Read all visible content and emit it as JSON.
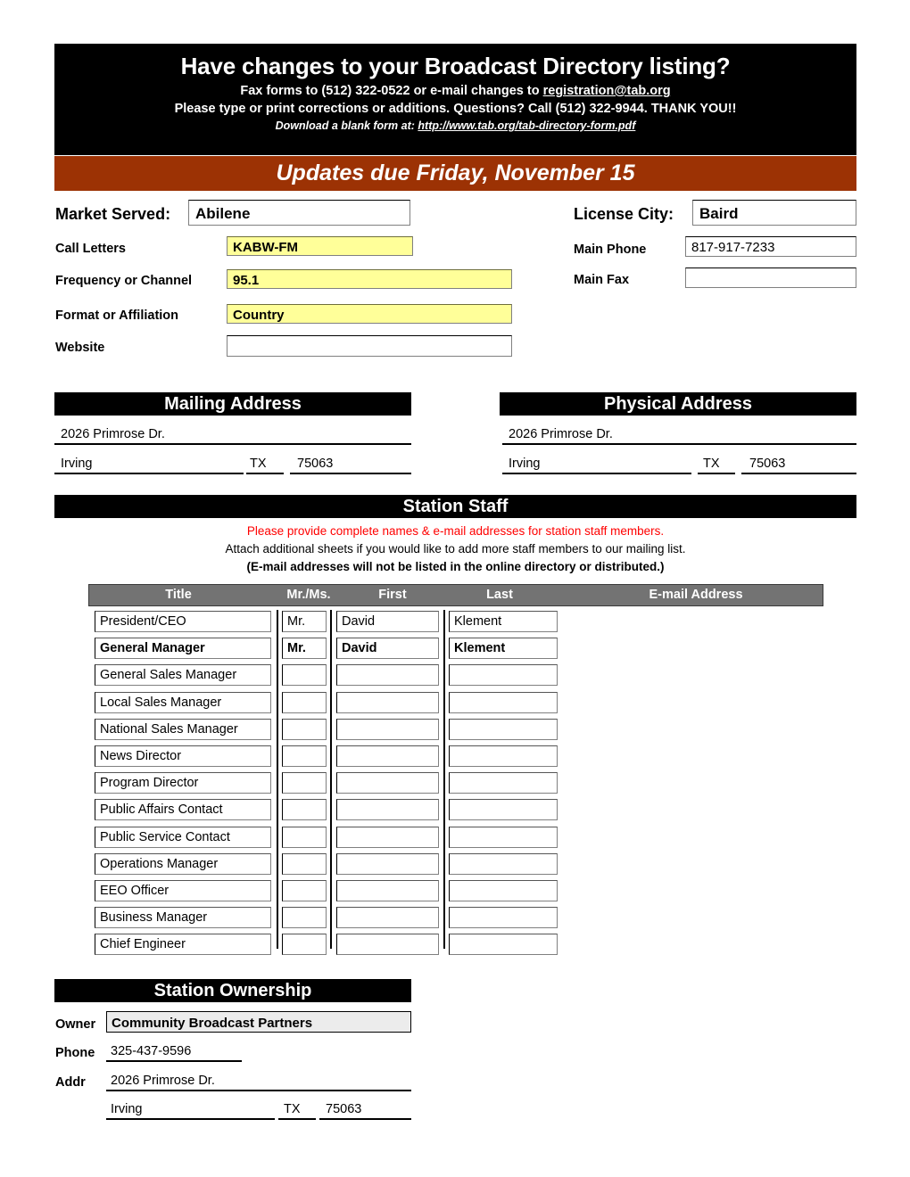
{
  "banner": {
    "title": "Have changes to your Broadcast Directory listing?",
    "line1_a": "Fax forms to (512) 322-0522 or e-mail changes to ",
    "line1_email": "registration@tab.org",
    "line2": "Please type or print corrections or additions. Questions?  Call (512) 322-9944. THANK YOU!!",
    "line3_a": "Download a blank form at: ",
    "line3_url": "http://www.tab.org/tab-directory-form.pdf",
    "due_notice": "Updates due Friday, November 15",
    "bg_color": "#000000",
    "due_bg_color": "#9c3204"
  },
  "station": {
    "market_served_label": "Market Served:",
    "market_served_value": "Abilene",
    "license_city_label": "License City:",
    "license_city_value": "Baird",
    "call_letters_label": "Call Letters",
    "call_letters_value": "KABW-FM",
    "frequency_label": "Frequency or Channel",
    "frequency_value": "95.1",
    "format_label": "Format or Affiliation",
    "format_value": "Country",
    "website_label": "Website",
    "website_value": "",
    "main_phone_label": "Main Phone",
    "main_phone_value": "817-917-7233",
    "main_fax_label": "Main Fax",
    "main_fax_value": "",
    "highlight_color": "#ffff99"
  },
  "mailing_address": {
    "header": "Mailing Address",
    "street": "2026 Primrose Dr.",
    "city": "Irving",
    "state": "TX",
    "zip": "75063"
  },
  "physical_address": {
    "header": "Physical Address",
    "street": "2026 Primrose Dr.",
    "city": "Irving",
    "state": "TX",
    "zip": "75063"
  },
  "staff": {
    "header": "Station Staff",
    "note_red": "Please provide complete names & e-mail addresses for station staff members.",
    "note_black": "Attach additional sheets if you would like to add more staff members to our mailing list.",
    "note_bold": "(E-mail addresses will not be listed in the online directory or distributed.)",
    "columns": [
      "Title",
      "Mr./Ms.",
      "First",
      "Last",
      "E-mail Address"
    ],
    "rows": [
      {
        "title": "President/CEO",
        "courtesy": "Mr.",
        "first": "David",
        "last": "Klement",
        "email": "",
        "bold": false
      },
      {
        "title": "General Manager",
        "courtesy": "Mr.",
        "first": "David",
        "last": "Klement",
        "email": "",
        "bold": true
      },
      {
        "title": "General Sales Manager",
        "courtesy": "",
        "first": "",
        "last": "",
        "email": "",
        "bold": false
      },
      {
        "title": "Local Sales Manager",
        "courtesy": "",
        "first": "",
        "last": "",
        "email": "",
        "bold": false
      },
      {
        "title": "National Sales Manager",
        "courtesy": "",
        "first": "",
        "last": "",
        "email": "",
        "bold": false
      },
      {
        "title": "News Director",
        "courtesy": "",
        "first": "",
        "last": "",
        "email": "",
        "bold": false
      },
      {
        "title": "Program Director",
        "courtesy": "",
        "first": "",
        "last": "",
        "email": "",
        "bold": false
      },
      {
        "title": "Public Affairs Contact",
        "courtesy": "",
        "first": "",
        "last": "",
        "email": "",
        "bold": false
      },
      {
        "title": "Public Service Contact",
        "courtesy": "",
        "first": "",
        "last": "",
        "email": "",
        "bold": false
      },
      {
        "title": "Operations Manager",
        "courtesy": "",
        "first": "",
        "last": "",
        "email": "",
        "bold": false
      },
      {
        "title": "EEO Officer",
        "courtesy": "",
        "first": "",
        "last": "",
        "email": "",
        "bold": false
      },
      {
        "title": "Business Manager",
        "courtesy": "",
        "first": "",
        "last": "",
        "email": "",
        "bold": false
      },
      {
        "title": "Chief Engineer",
        "courtesy": "",
        "first": "",
        "last": "",
        "email": "",
        "bold": false
      }
    ],
    "header_bg_color": "#737373"
  },
  "ownership": {
    "header": "Station Ownership",
    "owner_label": "Owner",
    "owner_value": "Community Broadcast Partners",
    "phone_label": "Phone",
    "phone_value": "325-437-9596",
    "addr_label": "Addr",
    "addr_street": "2026 Primrose Dr.",
    "addr_city": "Irving",
    "addr_state": "TX",
    "addr_zip": "75063",
    "owner_bg_color": "#ececec"
  }
}
